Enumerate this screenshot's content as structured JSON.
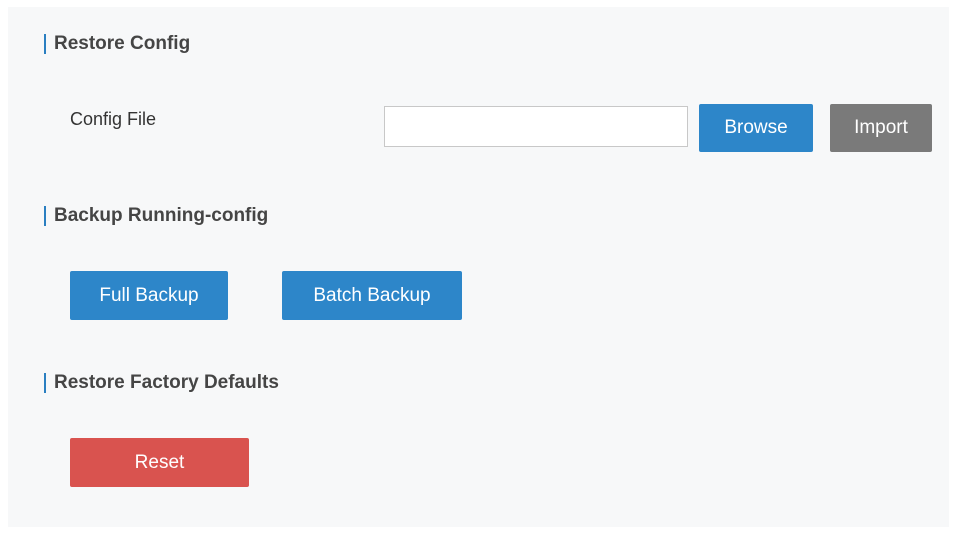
{
  "restore_config": {
    "title": "Restore Config",
    "config_file_label": "Config File",
    "config_file_value": "",
    "browse_label": "Browse",
    "import_label": "Import"
  },
  "backup": {
    "title": "Backup Running-config",
    "full_backup_label": "Full Backup",
    "batch_backup_label": "Batch Backup"
  },
  "factory": {
    "title": "Restore Factory Defaults",
    "reset_label": "Reset"
  },
  "colors": {
    "accent": "#2d86c9",
    "secondary": "#7a7a7a",
    "danger": "#d9534f",
    "panel_bg": "#f7f8f9"
  }
}
